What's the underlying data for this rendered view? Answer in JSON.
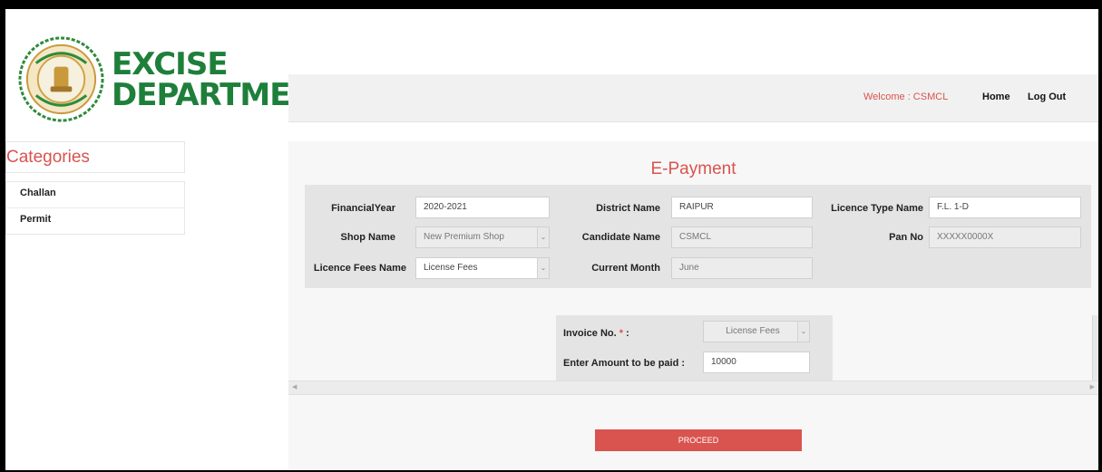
{
  "logo": {
    "line1": "EXCISE",
    "line2": "DEPARTMENT"
  },
  "topbar": {
    "welcome": "Welcome : CSMCL",
    "home": "Home",
    "logout": "Log Out"
  },
  "sidebar": {
    "heading": "Categories",
    "items": [
      {
        "label": "Challan"
      },
      {
        "label": "Permit"
      }
    ]
  },
  "main": {
    "title": "E-Payment",
    "fields": {
      "financial_year": {
        "label": "FinancialYear",
        "value": "2020-2021"
      },
      "district_name": {
        "label": "District Name",
        "value": "RAIPUR"
      },
      "licence_type_name": {
        "label": "Licence Type Name",
        "value": "F.L. 1-D"
      },
      "shop_name": {
        "label": "Shop Name",
        "value": "New Premium Shop"
      },
      "candidate_name": {
        "label": "Candidate Name",
        "value": "CSMCL"
      },
      "pan_no": {
        "label": "Pan No",
        "value": "XXXXX0000X"
      },
      "licence_fees_name": {
        "label": "Licence Fees Name",
        "value": "License Fees"
      },
      "current_month": {
        "label": "Current Month",
        "value": "June"
      }
    },
    "invoice": {
      "label": "Invoice No.",
      "required_mark": "*",
      "colon": ":",
      "value": "License Fees",
      "amount_label": "Enter Amount to be paid :",
      "amount_value": "10000"
    },
    "proceed_label": "PROCEED"
  },
  "colors": {
    "accent": "#d9534f",
    "logo_green": "#1e7f3a",
    "panel_bg": "#e4e4e4"
  },
  "icons": {
    "emblem": "state-emblem-icon",
    "dropdown": "chevron-down-icon"
  }
}
